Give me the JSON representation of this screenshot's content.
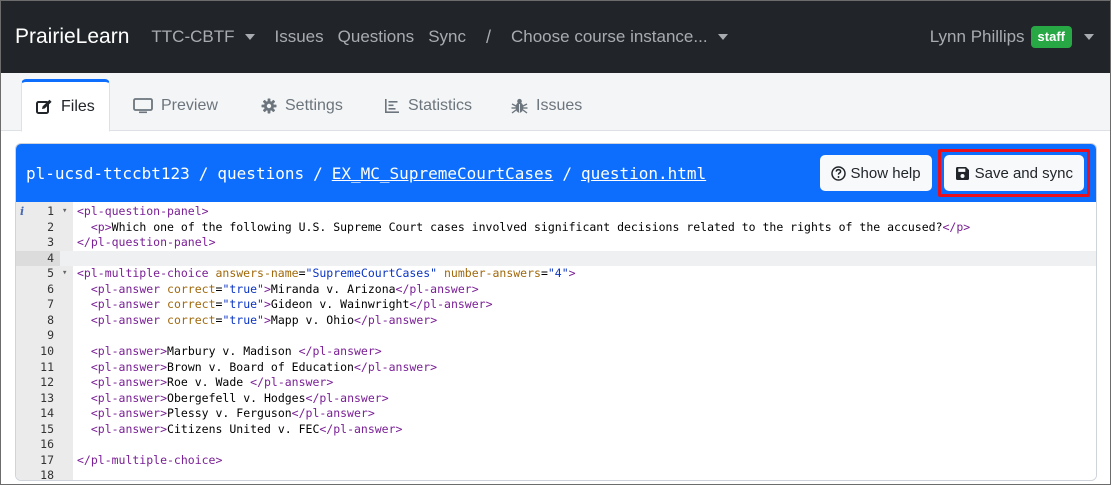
{
  "navbar": {
    "brand": "PrairieLearn",
    "course": "TTC-CBTF",
    "issues": "Issues",
    "questions": "Questions",
    "sync": "Sync",
    "separator": "/",
    "instance": "Choose course instance...",
    "user_name": "Lynn Phillips",
    "user_badge": "staff"
  },
  "tabs": [
    {
      "label": "Files",
      "icon": "edit-icon",
      "active": true
    },
    {
      "label": "Preview",
      "icon": "monitor-icon",
      "active": false
    },
    {
      "label": "Settings",
      "icon": "gear-icon",
      "active": false
    },
    {
      "label": "Statistics",
      "icon": "statistics-icon",
      "active": false
    },
    {
      "label": "Issues",
      "icon": "bug-icon",
      "active": false
    }
  ],
  "editor_header": {
    "path_root": "pl-ucsd-ttccbt123",
    "path_folder": "questions",
    "path_question": "EX_MC_SupremeCourtCases",
    "path_file": "question.html",
    "separator": "/",
    "show_help_label": "Show help",
    "save_label": "Save and sync"
  },
  "code_lines": [
    {
      "n": "1",
      "text": "<pl-question-panel>"
    },
    {
      "n": "2",
      "text": "  <p>Which one of the following U.S. Supreme Court cases involved significant decisions related to the rights of the accused?</p>"
    },
    {
      "n": "3",
      "text": "</pl-question-panel>"
    },
    {
      "n": "4",
      "text": ""
    },
    {
      "n": "5",
      "text": "<pl-multiple-choice answers-name=\"SupremeCourtCases\" number-answers=\"4\">"
    },
    {
      "n": "6",
      "text": "  <pl-answer correct=\"true\">Miranda v. Arizona</pl-answer>"
    },
    {
      "n": "7",
      "text": "  <pl-answer correct=\"true\">Gideon v. Wainwright</pl-answer>"
    },
    {
      "n": "8",
      "text": "  <pl-answer correct=\"true\">Mapp v. Ohio</pl-answer>"
    },
    {
      "n": "9",
      "text": ""
    },
    {
      "n": "10",
      "text": "  <pl-answer>Marbury v. Madison </pl-answer>"
    },
    {
      "n": "11",
      "text": "  <pl-answer>Brown v. Board of Education</pl-answer>"
    },
    {
      "n": "12",
      "text": "  <pl-answer>Roe v. Wade </pl-answer>"
    },
    {
      "n": "13",
      "text": "  <pl-answer>Obergefell v. Hodges</pl-answer>"
    },
    {
      "n": "14",
      "text": "  <pl-answer>Plessy v. Ferguson</pl-answer>"
    },
    {
      "n": "15",
      "text": "  <pl-answer>Citizens United v. FEC</pl-answer>"
    },
    {
      "n": "16",
      "text": ""
    },
    {
      "n": "17",
      "text": "</pl-multiple-choice>"
    },
    {
      "n": "18",
      "text": ""
    }
  ],
  "editor_state": {
    "current_line": "4",
    "folded_lines": [
      "1",
      "5"
    ],
    "info_marker_line": "1"
  },
  "colors": {
    "navbar": "#212529",
    "primary": "#0d6efd",
    "badge": "#28a745",
    "highlight": "#e8101e"
  }
}
